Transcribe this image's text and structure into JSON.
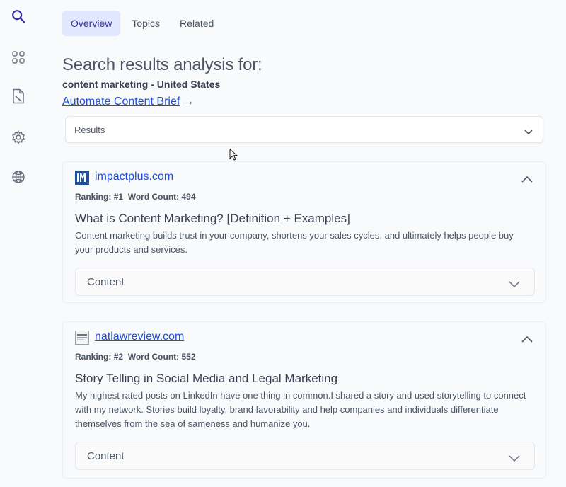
{
  "sidebar": {
    "icons": [
      "search-icon",
      "grid-icon",
      "document-icon",
      "gear-icon",
      "globe-icon"
    ],
    "accent": "#3730a3"
  },
  "tabs": [
    {
      "label": "Overview",
      "active": true
    },
    {
      "label": "Topics",
      "active": false
    },
    {
      "label": "Related",
      "active": false
    }
  ],
  "analysis": {
    "heading": "Search results analysis for:",
    "query": "content marketing - United States",
    "brief_link": "Automate Content Brief",
    "brief_arrow": "→"
  },
  "results_select": {
    "selected": "Results"
  },
  "results": [
    {
      "domain": "impactplus.com",
      "favicon": "IM",
      "ranking_label": "Ranking:",
      "ranking": "#1",
      "word_count_label": "Word Count:",
      "word_count": "494",
      "title": "What is Content Marketing? [Definition + Examples]",
      "description": "Content marketing builds trust in your company, shortens your sales cycles, and ultimately helps people buy your products and services.",
      "content_label": "Content"
    },
    {
      "domain": "natlawreview.com",
      "favicon": "NLR",
      "ranking_label": "Ranking:",
      "ranking": "#2",
      "word_count_label": "Word Count:",
      "word_count": "552",
      "title": "Story Telling in Social Media and Legal Marketing",
      "description": "My highest rated posts on LinkedIn have one thing in common.I shared a story and used storytelling to connect with my network. Stories build loyalty, brand favorability and help companies and individuals differentiate themselves from the sea of sameness and humanize you.",
      "content_label": "Content"
    }
  ],
  "colors": {
    "link": "#1d4ed8",
    "tab_active_bg": "#e0e7ff",
    "tab_active_text": "#3730a3",
    "background": "#f9fafb"
  }
}
